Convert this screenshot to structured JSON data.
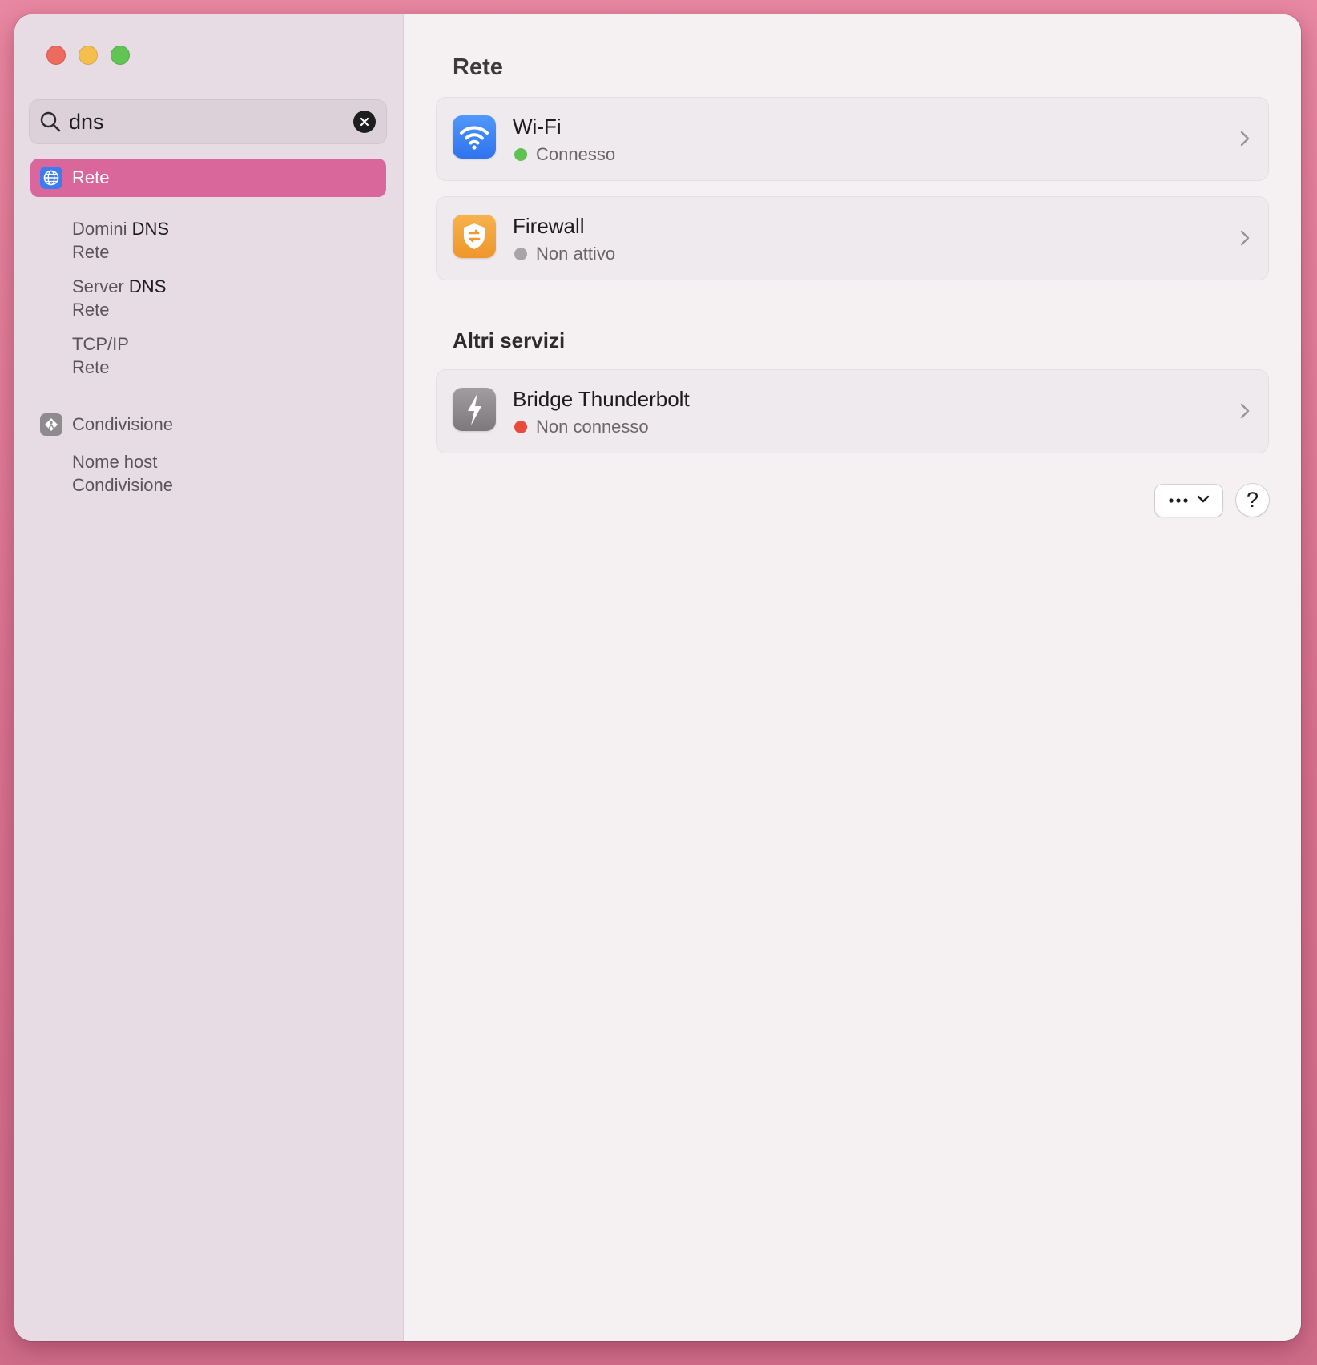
{
  "window": {
    "traffic_lights": [
      "close",
      "minimize",
      "zoom"
    ]
  },
  "sidebar": {
    "search": {
      "value": "dns",
      "icon": "search-icon",
      "clear_icon": "clear-icon"
    },
    "selected": {
      "label": "Rete",
      "icon": "globe-icon"
    },
    "results_network": [
      {
        "prefix": "Domini ",
        "match": "DNS",
        "sub": "Rete"
      },
      {
        "prefix": "Server ",
        "match": "DNS",
        "sub": "Rete"
      },
      {
        "prefix": "TCP/IP",
        "match": "",
        "sub": "Rete"
      }
    ],
    "sharing": {
      "label": "Condivisione",
      "icon": "sharing-icon"
    },
    "results_sharing": [
      {
        "prefix": "Nome host",
        "match": "",
        "sub": "Condivisione"
      }
    ]
  },
  "main": {
    "title": "Rete",
    "services": [
      {
        "name": "Wi-Fi",
        "status": "Connesso",
        "status_color": "#5ec250",
        "icon": "wifi-icon",
        "icon_color": "#3d8af7"
      },
      {
        "name": "Firewall",
        "status": "Non attivo",
        "status_color": "#a9a4a7",
        "icon": "firewall-shield-icon",
        "icon_color": "#f3a23a"
      }
    ],
    "other_title": "Altri servizi",
    "other_services": [
      {
        "name": "Bridge Thunderbolt",
        "status": "Non connesso",
        "status_color": "#e84b3c",
        "icon": "thunderbolt-icon",
        "icon_color": "#8e8a8d"
      }
    ],
    "actions": {
      "more_icon": "ellipsis-icon",
      "help_label": "?"
    }
  },
  "colors": {
    "accent": "#da679c",
    "sidebar_bg": "#e8dce4",
    "content_bg": "#f5f1f3"
  }
}
